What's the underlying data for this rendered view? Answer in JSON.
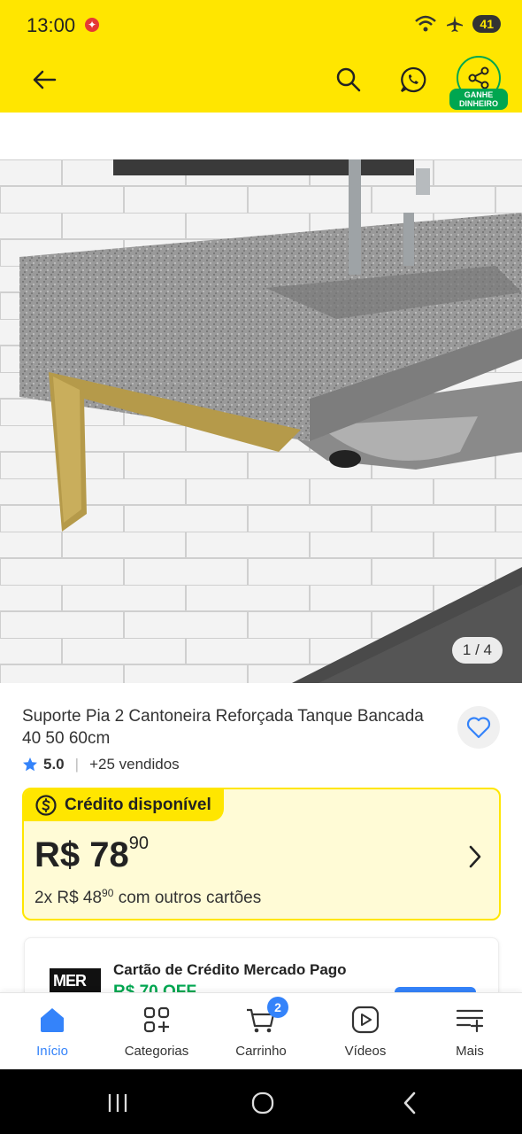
{
  "status_bar": {
    "time": "13:00",
    "battery": "41"
  },
  "header": {
    "ganhe_label": "GANHE DINHEIRO"
  },
  "gallery": {
    "counter": "1 / 4"
  },
  "product": {
    "title": "Suporte Pia 2 Cantoneira Reforçada Tanque Bancada 40 50 60cm",
    "rating": "5.0",
    "sold": "+25 vendidos"
  },
  "credit": {
    "tag": "Crédito disponível",
    "price_main": "R$ 78",
    "price_cents": "90",
    "install_prefix": "2x R$ 48",
    "install_cents": "90",
    "install_suffix": "com outros cartões"
  },
  "offer": {
    "logo": "MER",
    "title": "Cartão de Crédito Mercado Pago",
    "price": "R$ 70 OFF"
  },
  "bottom_nav": {
    "items": [
      {
        "label": "Início",
        "icon": "home-icon",
        "active": true
      },
      {
        "label": "Categorias",
        "icon": "categories-icon"
      },
      {
        "label": "Carrinho",
        "icon": "cart-icon",
        "badge": "2"
      },
      {
        "label": "Vídeos",
        "icon": "video-icon"
      },
      {
        "label": "Mais",
        "icon": "more-icon"
      }
    ]
  },
  "colors": {
    "brand_yellow": "#FFE600",
    "accent_blue": "#3483FA",
    "green": "#00a650"
  }
}
